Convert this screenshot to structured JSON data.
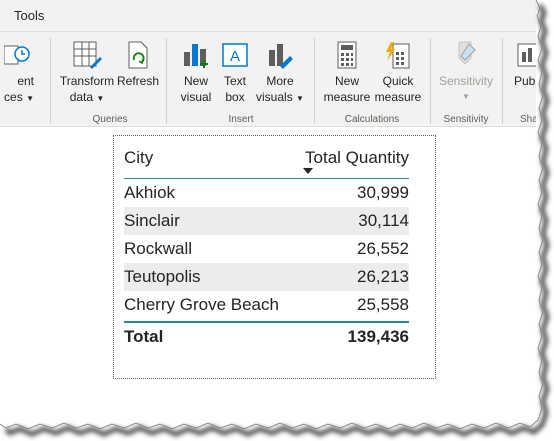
{
  "window": {
    "title_fragment": "Tools"
  },
  "ribbon": {
    "recent_sources_label_1": "ent",
    "recent_sources_label_2": "ces",
    "transform_label_1": "Transform",
    "transform_label_2": "data",
    "refresh_label": "Refresh",
    "queries_group": "Queries",
    "new_visual_label_1": "New",
    "new_visual_label_2": "visual",
    "text_box_label_1": "Text",
    "text_box_label_2": "box",
    "more_visuals_label_1": "More",
    "more_visuals_label_2": "visuals",
    "insert_group": "Insert",
    "new_measure_label_1": "New",
    "new_measure_label_2": "measure",
    "quick_measure_label_1": "Quick",
    "quick_measure_label_2": "measure",
    "calculations_group": "Calculations",
    "sensitivity_label": "Sensitivity",
    "sensitivity_group": "Sensitivity",
    "publish_label": "Publ",
    "share_group": "Shar"
  },
  "table": {
    "columns": [
      "City",
      "Total Quantity"
    ],
    "rows": [
      {
        "city": "Akhiok",
        "qty": "30,999"
      },
      {
        "city": "Sinclair",
        "qty": "30,114"
      },
      {
        "city": "Rockwall",
        "qty": "26,552"
      },
      {
        "city": "Teutopolis",
        "qty": "26,213"
      },
      {
        "city": "Cherry Grove Beach",
        "qty": "25,558"
      }
    ],
    "total_label": "Total",
    "total_value": "139,436"
  },
  "colors": {
    "accent_teal": "#2d8a8a",
    "ribbon_bg": "#f3f2f1"
  }
}
